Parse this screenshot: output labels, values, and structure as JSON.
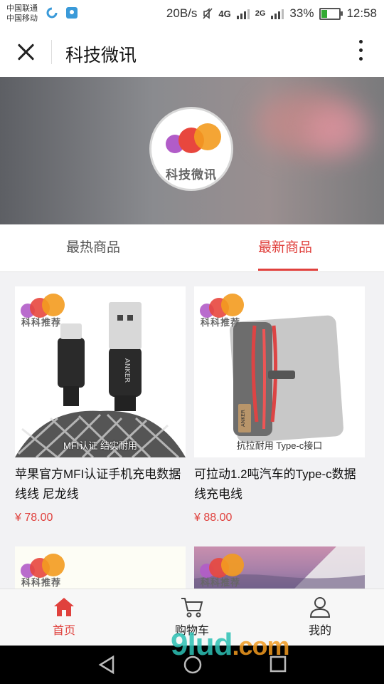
{
  "status_bar": {
    "carrier_1": "中国联通",
    "carrier_2": "中国移动",
    "speed": "20B/s",
    "network_1": "4G",
    "network_2": "2G",
    "battery": "33%",
    "time": "12:58"
  },
  "titlebar": {
    "title": "科技微讯"
  },
  "banner": {
    "logo_text": "科技微讯"
  },
  "tabs": [
    {
      "label": "最热商品",
      "active": false
    },
    {
      "label": "最新商品",
      "active": true
    }
  ],
  "products": [
    {
      "name": "苹果官方MFI认证手机充电数据线线 尼龙线",
      "price": "¥ 78.00",
      "badge": "科科推荐",
      "caption": "MFI认证 结实耐用",
      "brand": "ANKER"
    },
    {
      "name": "可拉动1.2吨汽车的Type-c数据线充电线",
      "price": "¥ 88.00",
      "badge": "科科推荐",
      "caption": "抗拉耐用 Type-c接口",
      "brand": "ANKER"
    },
    {
      "badge": "科科推荐"
    },
    {
      "badge": "科科推荐"
    }
  ],
  "bottom_nav": [
    {
      "label": "首页",
      "icon": "home-icon",
      "active": true
    },
    {
      "label": "购物车",
      "icon": "cart-icon",
      "active": false
    },
    {
      "label": "我的",
      "icon": "user-icon",
      "active": false
    }
  ],
  "watermark": {
    "main": "9lud",
    "suffix": ".com"
  },
  "colors": {
    "accent": "#e0413d",
    "logo_red": "#e8473e",
    "logo_orange": "#f39b1f",
    "logo_purple": "#b15cc8"
  }
}
